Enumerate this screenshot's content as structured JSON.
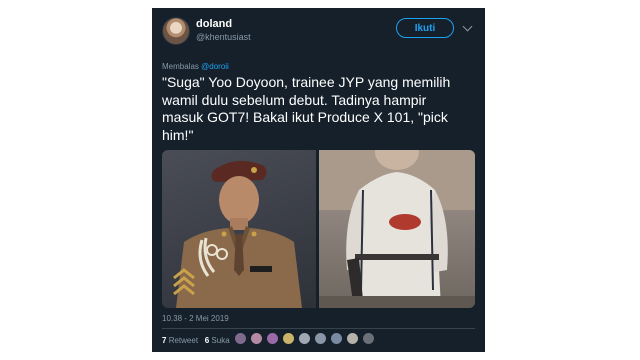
{
  "tweet": {
    "author": {
      "display_name": "doland",
      "handle": "@khentusiast"
    },
    "follow_label": "Ikuti",
    "reply_context": {
      "prefix": "Membalas",
      "mention": "@doroii"
    },
    "text_lines": [
      "\"Suga\" Yoo Doyoon, trainee JYP yang memilih",
      "wamil dulu sebelum debut. Tadinya hampir",
      "masuk GOT7! Bakal ikut Produce X 101, \"pick",
      "him!\""
    ],
    "timestamp": "10.38 - 2 Mei 2019",
    "stats": {
      "retweets_count": "7",
      "retweets_label": "Retweet",
      "likes_count": "6",
      "likes_label": "Suka"
    },
    "liker_avatar_colors": [
      "#7f6a8e",
      "#b58aa5",
      "#9a6aa8",
      "#c9b46a",
      "#a0a8b4",
      "#8a96a6",
      "#7a8aa2",
      "#b6b0aa",
      "#6b6f77"
    ],
    "media_icons": [
      "military-portrait-photo",
      "child-outfit-photo"
    ]
  },
  "colors": {
    "card_background": "#15202b",
    "accent": "#1da1f2",
    "secondary_text": "#8899a6"
  }
}
